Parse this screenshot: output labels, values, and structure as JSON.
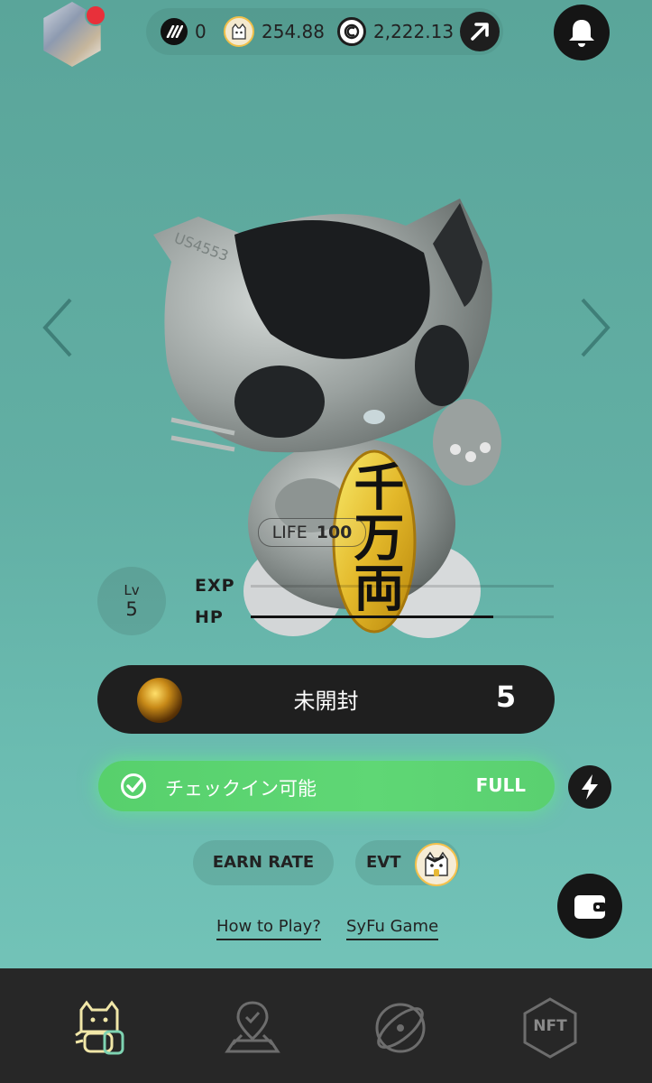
{
  "header": {
    "balances": [
      {
        "icon": "stepn-icon",
        "value": "0"
      },
      {
        "icon": "cat-token-icon",
        "value": "254.88"
      },
      {
        "icon": "coin-icon",
        "value": "2,222.13"
      }
    ]
  },
  "character": {
    "life_label": "LIFE",
    "life_value": "100",
    "level_label": "Lv",
    "level_value": "5",
    "exp_label": "EXP",
    "hp_label": "HP",
    "exp_fraction": 0.0,
    "hp_fraction": 0.8,
    "coin_text": "千万両"
  },
  "unopened": {
    "label": "未開封",
    "count": "5"
  },
  "checkin": {
    "label": "チェックイン可能",
    "status": "FULL"
  },
  "buttons": {
    "earn_rate": "EARN RATE",
    "evt": "EVT"
  },
  "links": {
    "how_to_play": "How to Play?",
    "syfu_game": "SyFu Game"
  },
  "bottom_nav": {
    "nft_label": "NFT"
  },
  "colors": {
    "accent_green": "#5fd775",
    "background": "#62afa4",
    "dark": "#1f1f1f"
  }
}
